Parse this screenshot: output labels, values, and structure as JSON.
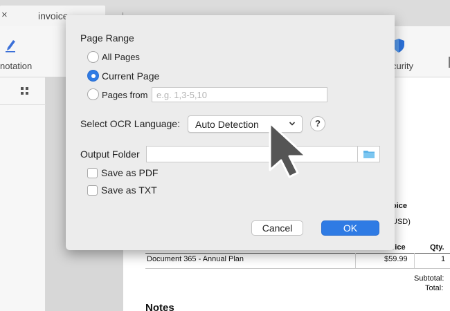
{
  "tab": {
    "close": "×",
    "title": "invoice"
  },
  "toolbar": {
    "annotation_label": "notation",
    "security_label": "curity"
  },
  "document": {
    "heading_fragment": "oice",
    "currency_fragment": "USD)",
    "col_price": "rice",
    "col_qty": "Qty.",
    "row_item": "Document 365 - Annual Plan",
    "row_price": "$59.99",
    "row_qty": "1",
    "subtotal_label": "Subtotal:",
    "total_label": "Total:",
    "notes_heading": "Notes"
  },
  "dialog": {
    "page_range_title": "Page Range",
    "all_pages": "All Pages",
    "current_page": "Current Page",
    "pages_from": "Pages from",
    "pages_from_placeholder": "e.g. 1,3-5,10",
    "pages_from_value": "",
    "selected_range": "current_page",
    "ocr_language_label": "Select OCR Language:",
    "ocr_language_value": "Auto Detection",
    "help": "?",
    "output_folder_label": "Output Folder",
    "output_folder_value": "",
    "save_pdf": "Save as PDF",
    "save_txt": "Save as TXT",
    "save_pdf_checked": false,
    "save_txt_checked": false,
    "cancel": "Cancel",
    "ok": "OK"
  },
  "colors": {
    "accent": "#2f7be4",
    "folder": "#5cb3e8",
    "annotation_icon": "#3a6fd8",
    "security_icon": "#2d72d9",
    "cursor": "#555555"
  },
  "icons": {
    "annotation": "pen-icon",
    "security": "shield-icon",
    "thumbnails": "grid-icon",
    "folder": "folder-icon",
    "dropdown": "chevron-down-icon",
    "cursor": "arrow-cursor-icon"
  }
}
